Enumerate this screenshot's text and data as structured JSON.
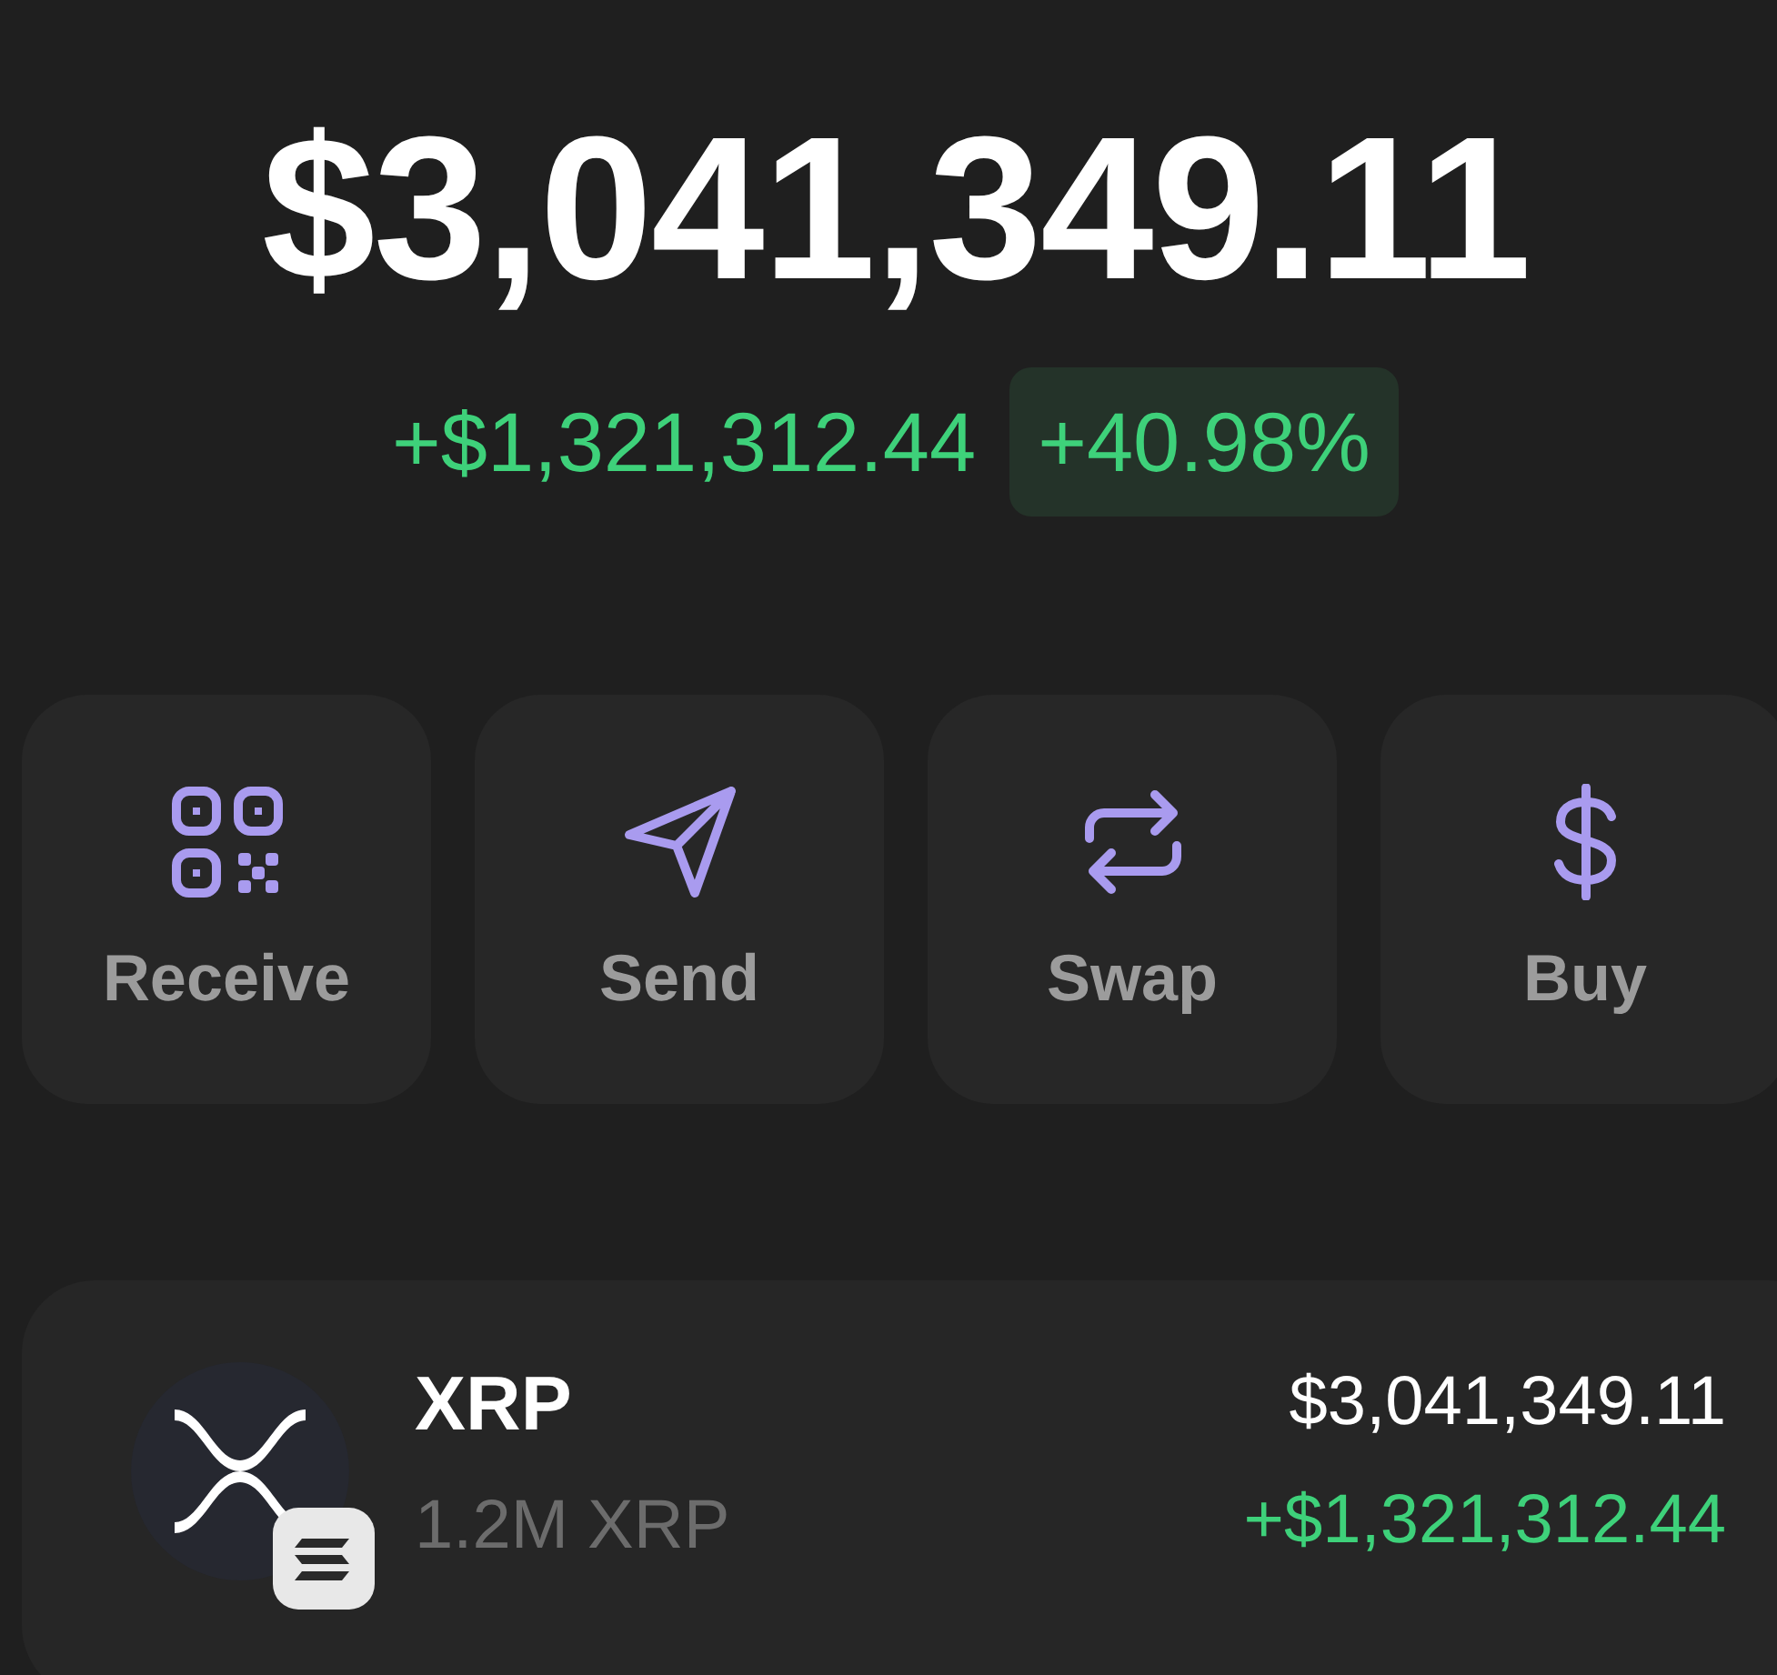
{
  "balance": "$3,041,349.11",
  "change": {
    "amount": "+$1,321,312.44",
    "percent": "+40.98%"
  },
  "actions": [
    {
      "kind": "receive",
      "label": "Receive"
    },
    {
      "kind": "send",
      "label": "Send"
    },
    {
      "kind": "swap",
      "label": "Swap"
    },
    {
      "kind": "buy",
      "label": "Buy"
    }
  ],
  "assets": [
    {
      "name": "XRP",
      "quantity": "1.2M XRP",
      "value": "$3,041,349.11",
      "change": "+$1,321,312.44"
    }
  ]
}
